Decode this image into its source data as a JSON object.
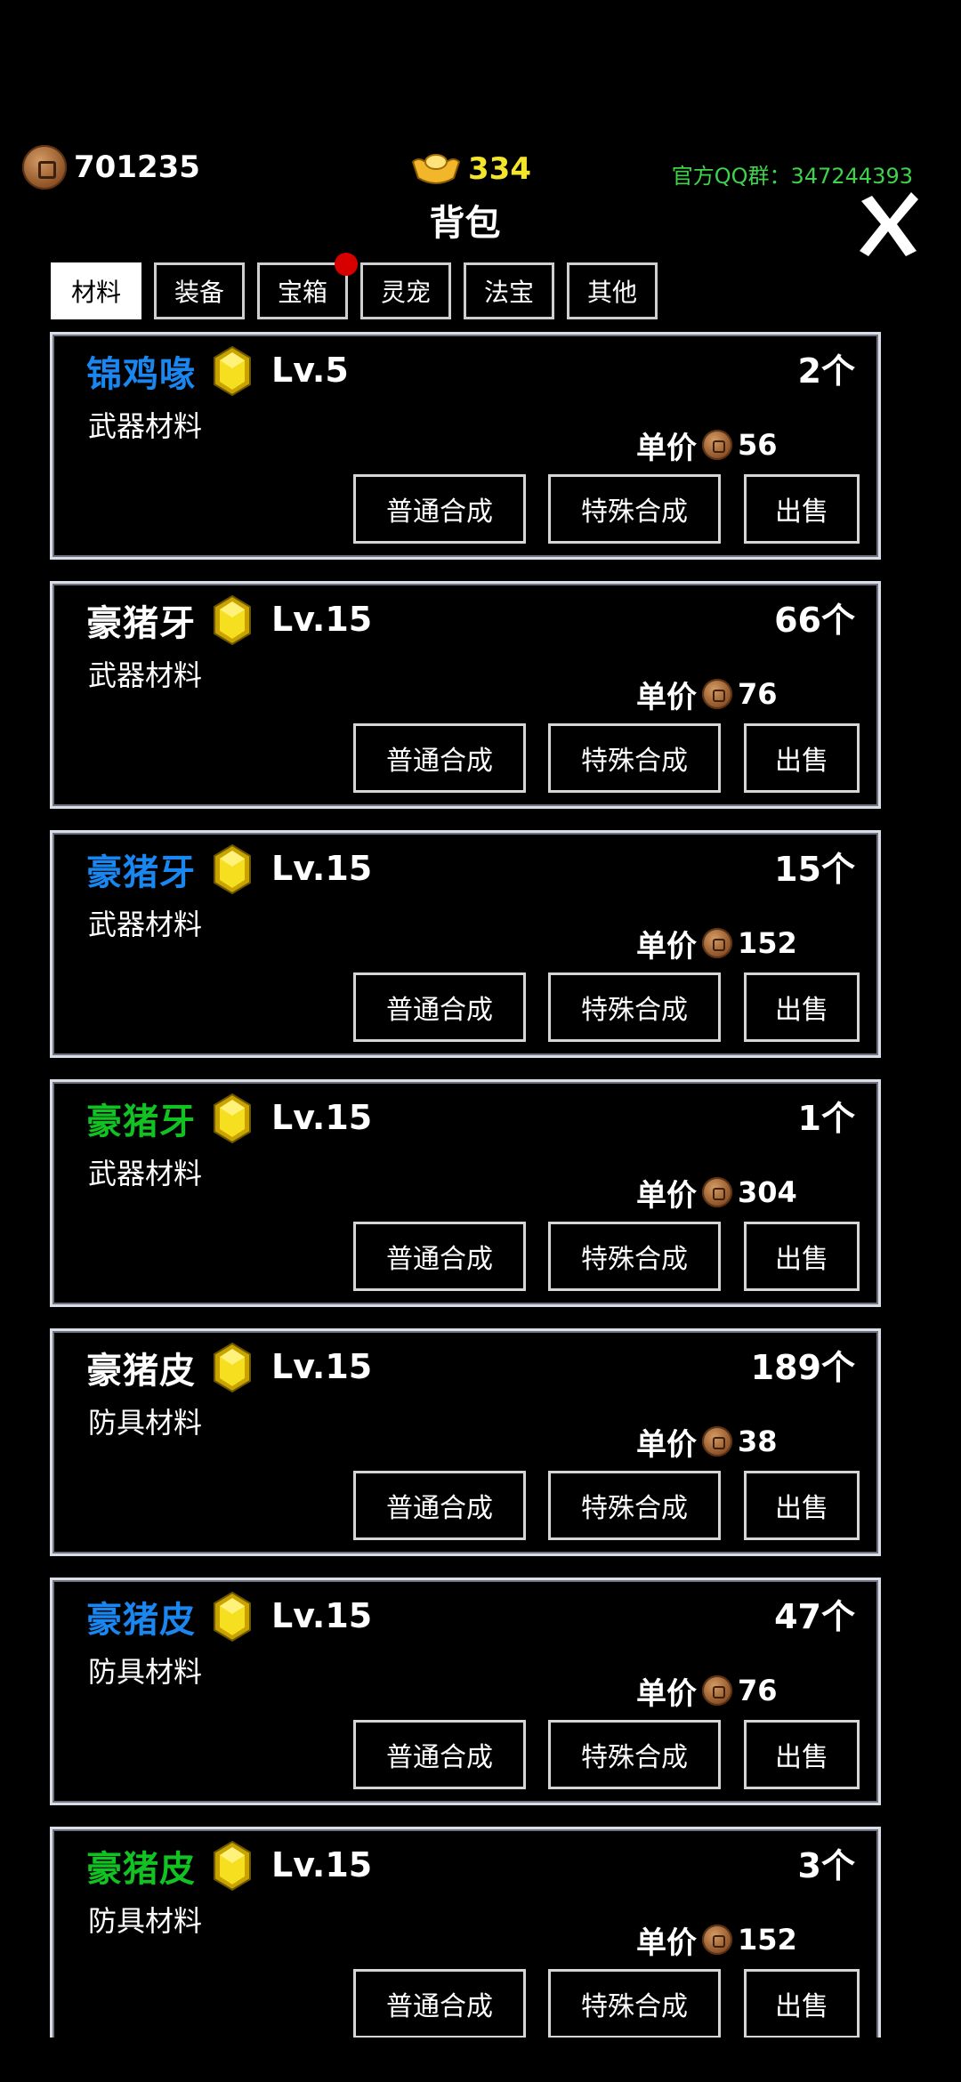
{
  "header": {
    "copper_amount": "701235",
    "gold_amount": "334",
    "qq_group": "官方QQ群：347244393",
    "title": "背包",
    "close_icon": "close-x-icon"
  },
  "tabs": [
    {
      "label": "材料",
      "active": true
    },
    {
      "label": "装备",
      "active": false
    },
    {
      "label": "宝箱",
      "active": false,
      "badge": true
    },
    {
      "label": "灵宠",
      "active": false
    },
    {
      "label": "法宝",
      "active": false
    },
    {
      "label": "其他",
      "active": false
    }
  ],
  "buttons": {
    "normal": "普通合成",
    "special": "特殊合成",
    "sell": "出售"
  },
  "price_label": "单价",
  "colors": {
    "blue": "#1a86f0",
    "green": "#12c223",
    "white": "#ffffff",
    "gold": "#f3e52b",
    "qq": "#3fd24b",
    "badge": "#d70000"
  },
  "items": [
    {
      "name": "锦鸡喙",
      "color": "blue",
      "level": "Lv.5",
      "count": "2个",
      "category": "武器材料",
      "price": "56"
    },
    {
      "name": "豪猪牙",
      "color": "white",
      "level": "Lv.15",
      "count": "66个",
      "category": "武器材料",
      "price": "76"
    },
    {
      "name": "豪猪牙",
      "color": "blue",
      "level": "Lv.15",
      "count": "15个",
      "category": "武器材料",
      "price": "152"
    },
    {
      "name": "豪猪牙",
      "color": "green",
      "level": "Lv.15",
      "count": "1个",
      "category": "武器材料",
      "price": "304"
    },
    {
      "name": "豪猪皮",
      "color": "white",
      "level": "Lv.15",
      "count": "189个",
      "category": "防具材料",
      "price": "38"
    },
    {
      "name": "豪猪皮",
      "color": "blue",
      "level": "Lv.15",
      "count": "47个",
      "category": "防具材料",
      "price": "76"
    },
    {
      "name": "豪猪皮",
      "color": "green",
      "level": "Lv.15",
      "count": "3个",
      "category": "防具材料",
      "price": "152"
    }
  ]
}
